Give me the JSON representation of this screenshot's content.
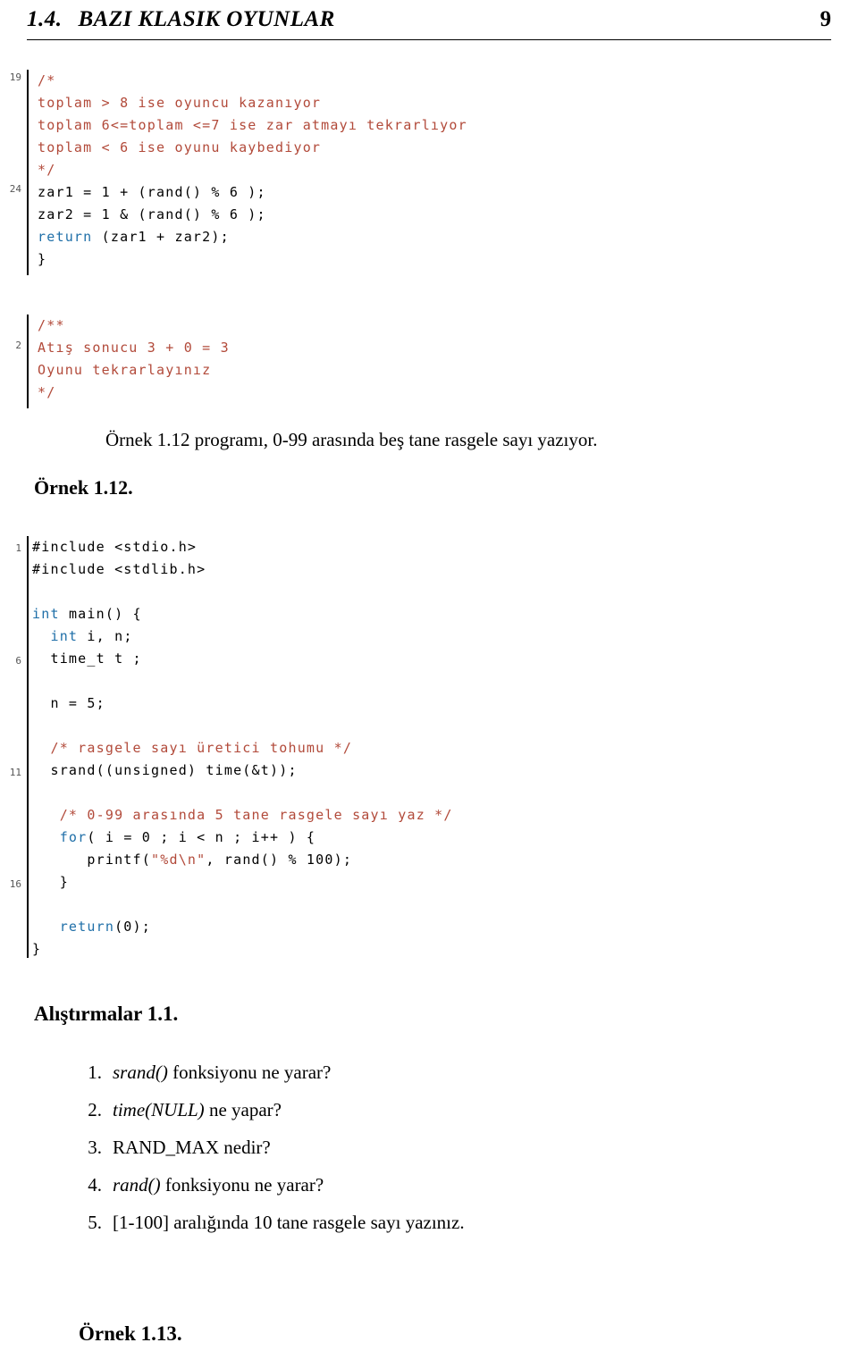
{
  "header": {
    "section_number": "1.4.",
    "section_title": "BAZI KLASIK OYUNLAR",
    "page_number": "9"
  },
  "code_block_1": {
    "line_numbers": [
      "19",
      "24"
    ],
    "lines": [
      [
        {
          "t": "/*",
          "c": "cmt"
        }
      ],
      [
        {
          "t": "toplam > 8 ise oyuncu kazanıyor",
          "c": "cmt"
        }
      ],
      [
        {
          "t": "toplam 6<=toplam <=7 ise zar atmayı tekrarlıyor",
          "c": "cmt"
        }
      ],
      [
        {
          "t": "toplam < 6 ise oyunu kaybediyor",
          "c": "cmt"
        }
      ],
      [
        {
          "t": "*/",
          "c": "cmt"
        }
      ],
      [
        {
          "t": "zar1 = 1 + (rand() % 6 );",
          "c": "pl"
        }
      ],
      [
        {
          "t": "zar2 = 1 & (rand() % 6 );",
          "c": "pl"
        }
      ],
      [
        {
          "t": "return ",
          "c": "kw"
        },
        {
          "t": "(zar1 + zar2);",
          "c": "pl"
        }
      ],
      [
        {
          "t": "}",
          "c": "pl"
        }
      ]
    ]
  },
  "code_block_2": {
    "line_numbers": [
      "2"
    ],
    "lines": [
      [
        {
          "t": "/**",
          "c": "cmt"
        }
      ],
      [
        {
          "t": "Atış sonucu 3 + 0 = 3",
          "c": "cmt"
        }
      ],
      [
        {
          "t": "Oyunu tekrarlayınız",
          "c": "cmt"
        }
      ],
      [
        {
          "t": "*/",
          "c": "cmt"
        }
      ]
    ]
  },
  "paragraph": "Örnek 1.12 programı, 0-99 arasında beş tane rasgele sayı yazıyor.",
  "example_caption": "Örnek 1.12.",
  "code_block_3": {
    "line_numbers": [
      "1",
      "6",
      "11",
      "16"
    ],
    "lines": [
      [
        {
          "t": "#include <stdio.h>",
          "c": "pl"
        }
      ],
      [
        {
          "t": "#include <stdlib.h>",
          "c": "pl"
        }
      ],
      [
        {
          "t": "",
          "c": "pl"
        }
      ],
      [
        {
          "t": "int ",
          "c": "kw"
        },
        {
          "t": "main() {",
          "c": "pl"
        }
      ],
      [
        {
          "t": "  int ",
          "c": "kw"
        },
        {
          "t": "i, n;",
          "c": "pl"
        }
      ],
      [
        {
          "t": "  time_t t ;",
          "c": "pl"
        }
      ],
      [
        {
          "t": "",
          "c": "pl"
        }
      ],
      [
        {
          "t": "  n = 5;",
          "c": "pl"
        }
      ],
      [
        {
          "t": "",
          "c": "pl"
        }
      ],
      [
        {
          "t": "  /* rasgele sayı üretici tohumu */",
          "c": "cmt"
        }
      ],
      [
        {
          "t": "  srand((unsigned) time(&t));",
          "c": "pl"
        }
      ],
      [
        {
          "t": "",
          "c": "pl"
        }
      ],
      [
        {
          "t": "   /* 0-99 arasında 5 tane rasgele sayı yaz */",
          "c": "cmt"
        }
      ],
      [
        {
          "t": "   for",
          "c": "kw"
        },
        {
          "t": "( i = 0 ; i < n ; i++ ) {",
          "c": "pl"
        }
      ],
      [
        {
          "t": "      printf(",
          "c": "pl"
        },
        {
          "t": "\"%d\\n\"",
          "c": "str"
        },
        {
          "t": ", rand() % 100);",
          "c": "pl"
        }
      ],
      [
        {
          "t": "   }",
          "c": "pl"
        }
      ],
      [
        {
          "t": "",
          "c": "pl"
        }
      ],
      [
        {
          "t": "   return",
          "c": "kw"
        },
        {
          "t": "(0);",
          "c": "pl"
        }
      ],
      [
        {
          "t": "}",
          "c": "pl"
        }
      ]
    ]
  },
  "exercises": {
    "title": "Alıştırmalar 1.1.",
    "items": [
      {
        "num": "1.",
        "italic": "srand()",
        "rest": " fonksiyonu ne yarar?"
      },
      {
        "num": "2.",
        "italic": "time(NULL)",
        "rest": " ne yapar?"
      },
      {
        "num": "3.",
        "italic": "",
        "rest": "RAND_MAX nedir?"
      },
      {
        "num": "4.",
        "italic": "rand()",
        "rest": " fonksiyonu ne yarar?"
      },
      {
        "num": "5.",
        "italic": "",
        "rest": "[1-100] aralığında 10 tane rasgele sayı yazınız."
      }
    ]
  },
  "footer_caption": "Örnek 1.13."
}
